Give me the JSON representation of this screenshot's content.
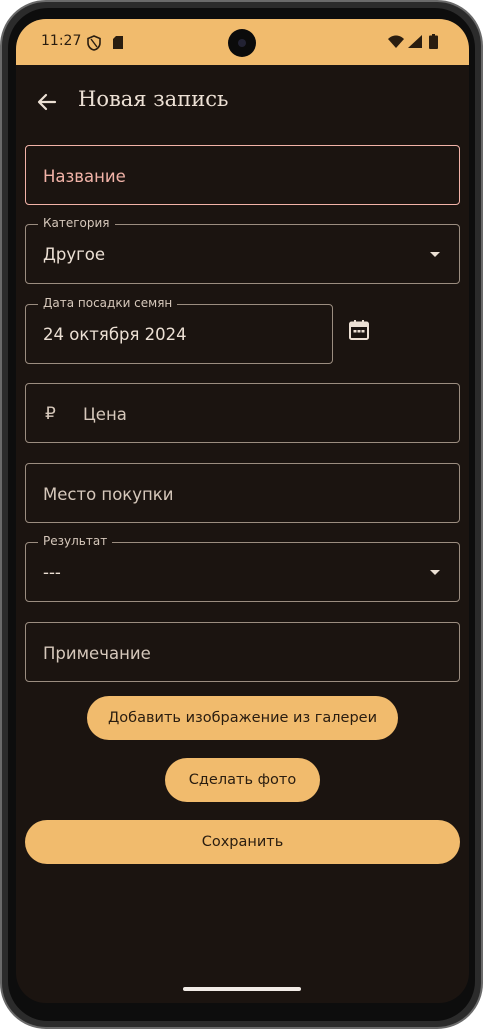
{
  "status_bar": {
    "time": "11:27",
    "icons": [
      "shield-icon",
      "sd-card-icon",
      "wifi-icon",
      "signal-icon",
      "battery-icon"
    ],
    "background": "#f1bb6d"
  },
  "app_bar": {
    "title": "Новая запись",
    "back_icon": "arrow-back-icon"
  },
  "form": {
    "name_placeholder": "Название",
    "category": {
      "label": "Категория",
      "value": "Другое"
    },
    "seed_date": {
      "label": "Дата посадки семян",
      "value": "24 октября 2024",
      "calendar_icon": "calendar-icon"
    },
    "price": {
      "currency": "₽",
      "placeholder": "Цена"
    },
    "purchase_place_placeholder": "Место покупки",
    "result": {
      "label": "Результат",
      "value": "---"
    },
    "note_placeholder": "Примечание"
  },
  "buttons": {
    "add_from_gallery": "Добавить изображение из галереи",
    "take_photo": "Сделать фото",
    "save": "Сохранить"
  },
  "colors": {
    "accent": "#f1bb6d",
    "background": "#1b1410",
    "error": "#f2b3a8",
    "text": "#ece0d4"
  }
}
